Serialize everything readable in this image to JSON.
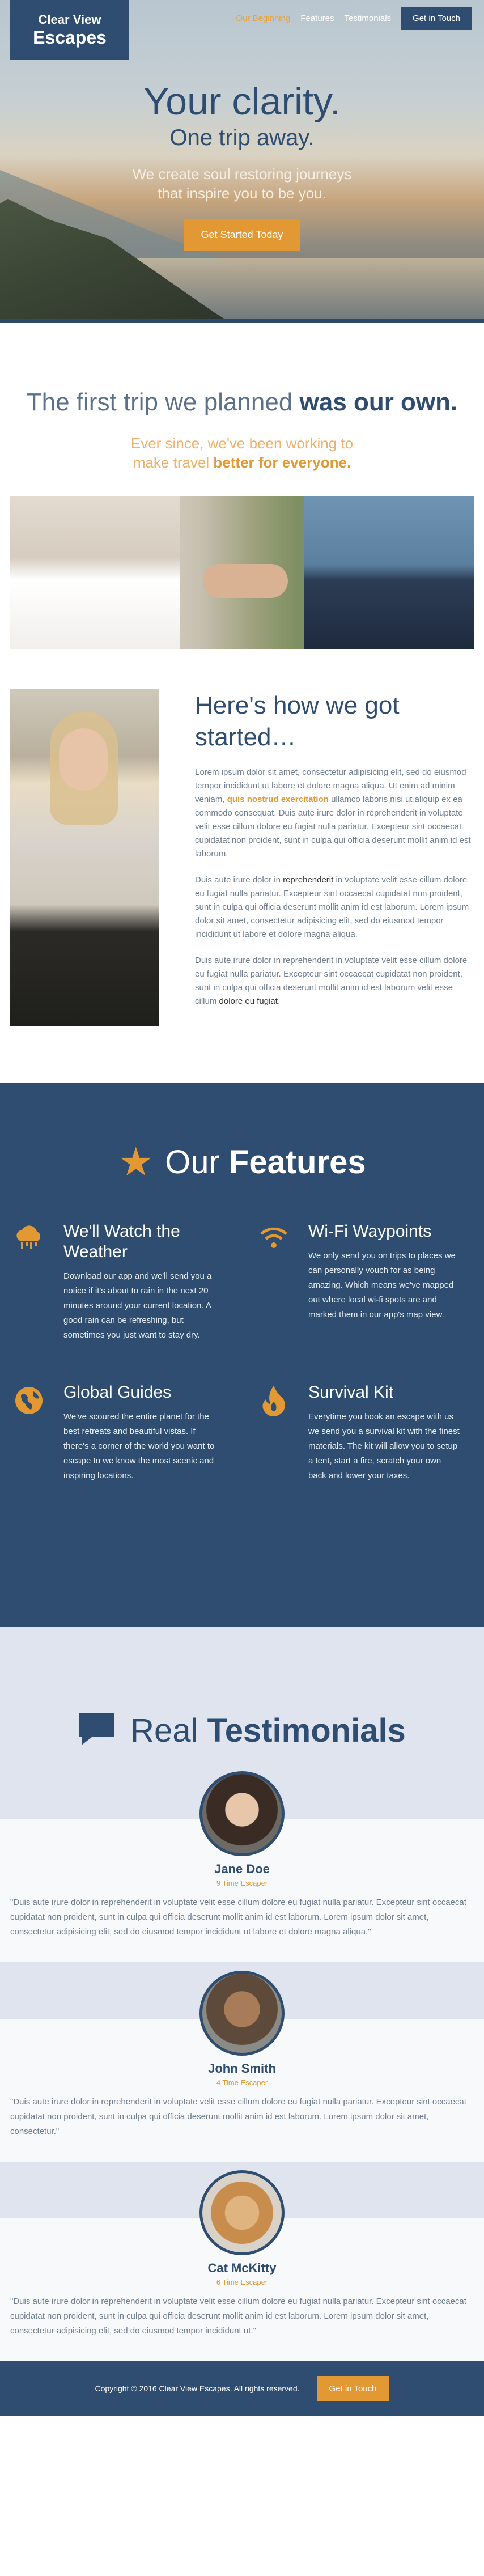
{
  "brand": {
    "line1": "Clear View",
    "line2": "Escapes"
  },
  "nav": {
    "items": [
      {
        "label": "Our Beginning"
      },
      {
        "label": "Features"
      },
      {
        "label": "Testimonials"
      }
    ],
    "cta": "Get in Touch"
  },
  "hero": {
    "title": "Your clarity.",
    "subtitle": "One trip away.",
    "desc_line1": "We create soul restoring journeys",
    "desc_line2": "that inspire you to be you.",
    "button": "Get Started Today"
  },
  "first_trip": {
    "title_light": "The first trip we planned ",
    "title_bold": "was our own.",
    "sub_line1": "Ever since, we've been working to",
    "sub_line2_light": "make travel ",
    "sub_line2_bold": "better for everyone."
  },
  "story": {
    "title": "Here's how we got started…",
    "p1_a": "Lorem ipsum dolor sit amet, consectetur adipisicing elit, sed do eiusmod tempor incididunt ut labore et dolore magna aliqua. Ut enim ad minim veniam, ",
    "p1_link": "quis nostrud exercitation",
    "p1_b": " ullamco laboris nisi ut aliquip ex ea commodo consequat. Duis aute irure dolor in reprehenderit in voluptate velit esse cillum dolore eu fugiat nulla pariatur. Excepteur sint occaecat cupidatat non proident, sunt in culpa qui officia deserunt mollit anim id est laborum.",
    "p2_a": "Duis aute irure dolor in ",
    "p2_b": "reprehenderit",
    "p2_c": " in voluptate velit esse cillum dolore eu fugiat nulla pariatur. Excepteur sint occaecat cupidatat non proident, sunt in culpa qui officia deserunt mollit anim id est laborum. Lorem ipsum dolor sit amet, consectetur adipisicing elit, sed do eiusmod tempor incididunt ut labore et dolore magna aliqua.",
    "p3_a": "Duis aute irure dolor in reprehenderit in voluptate velit esse cillum dolore eu fugiat nulla pariatur. Excepteur sint occaecat cupidatat non proident, sunt in culpa qui officia deserunt mollit anim id est laborum velit esse cillum ",
    "p3_b": "dolore eu fugiat",
    "p3_c": "."
  },
  "features": {
    "title_light": "Our ",
    "title_bold": "Features",
    "items": [
      {
        "title": "We'll Watch the Weather",
        "icon": "weather-cloud-icon",
        "desc": "Download our app and we'll send you a notice if it's about to rain in the next 20 minutes around your current location. A good rain can be refreshing, but sometimes you just want to stay dry."
      },
      {
        "title": "Wi-Fi Waypoints",
        "icon": "wifi-icon",
        "desc": "We only send you on trips to places we can personally vouch for as being amazing. Which means we've mapped out where local wi-fi spots are and marked them in our app's map view."
      },
      {
        "title": "Global Guides",
        "icon": "globe-icon",
        "desc": "We've scoured the entire planet for the best retreats and beautiful vistas. If there's a corner of the world you want to escape to we know the most scenic and inspiring locations."
      },
      {
        "title": "Survival Kit",
        "icon": "fire-icon",
        "desc": "Everytime you book an escape with us we send you a survival kit with the finest materials. The kit will allow you to setup a tent, start a fire, scratch your own back and lower your taxes."
      }
    ]
  },
  "testimonials": {
    "title_light": "Real ",
    "title_bold": "Testimonials",
    "items": [
      {
        "name": "Jane Doe",
        "role": "9 Time Escaper",
        "quote": "\"Duis aute irure dolor in reprehenderit in voluptate velit esse cillum dolore eu fugiat nulla pariatur. Excepteur sint occaecat cupidatat non proident, sunt in culpa qui officia deserunt mollit anim id est laborum. Lorem ipsum dolor sit amet, consectetur adipisicing elit, sed do eiusmod tempor incididunt ut labore et dolore magna aliqua.\""
      },
      {
        "name": "John Smith",
        "role": "4 Time Escaper",
        "quote": "\"Duis aute irure dolor in reprehenderit in voluptate velit esse cillum dolore eu fugiat nulla pariatur. Excepteur sint occaecat cupidatat non proident, sunt in culpa qui officia deserunt mollit anim id est laborum. Lorem ipsum dolor sit amet, consectetur.\""
      },
      {
        "name": "Cat McKitty",
        "role": "6 Time Escaper",
        "quote": "\"Duis aute irure dolor in reprehenderit in voluptate velit esse cillum dolore eu fugiat nulla pariatur. Excepteur sint occaecat cupidatat non proident, sunt in culpa qui officia deserunt mollit anim id est laborum. Lorem ipsum dolor sit amet, consectetur adipisicing elit, sed do eiusmod tempor incididunt ut.\""
      }
    ]
  },
  "footer": {
    "copyright": "Copyright © 2016 Clear View Escapes. All rights reserved.",
    "cta": "Get in Touch"
  },
  "colors": {
    "navy": "#2f4d70",
    "accent": "#e29833",
    "pale": "#dfe4ee"
  }
}
